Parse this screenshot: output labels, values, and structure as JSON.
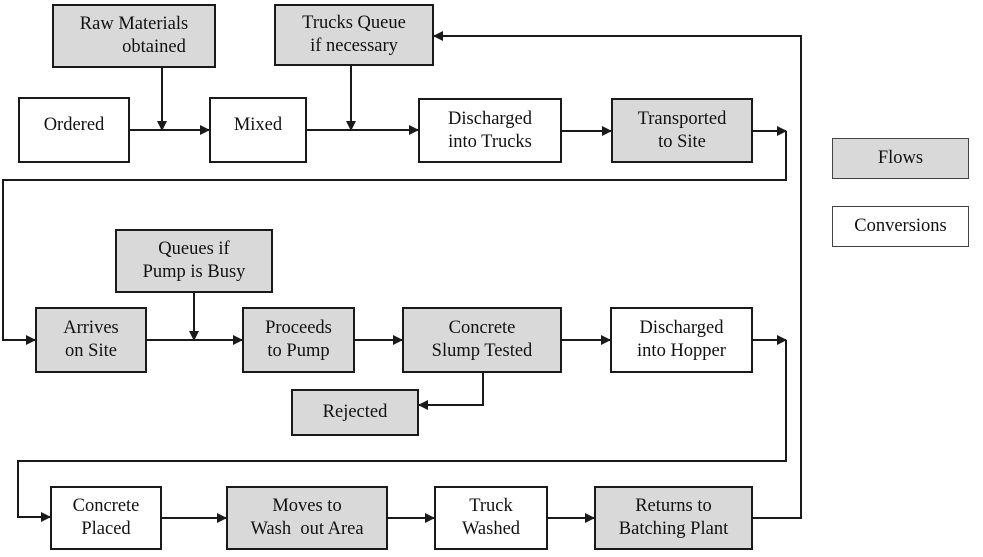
{
  "colors": {
    "flow_fill": "#d9d9d9",
    "conversion_fill": "#ffffff",
    "line": "#1a1a1a"
  },
  "nodes": {
    "raw_materials": {
      "type": "flow",
      "lines": [
        "Raw Materials",
        "obtained"
      ]
    },
    "trucks_queue": {
      "type": "flow",
      "lines": [
        "Trucks Queue",
        "if necessary"
      ]
    },
    "ordered": {
      "type": "conversion",
      "lines": [
        "Ordered"
      ]
    },
    "mixed": {
      "type": "conversion",
      "lines": [
        "Mixed"
      ]
    },
    "discharged_trucks": {
      "type": "conversion",
      "lines": [
        "Discharged",
        "into Trucks"
      ]
    },
    "transported": {
      "type": "flow",
      "lines": [
        "Transported",
        "to Site"
      ]
    },
    "queues_pump": {
      "type": "flow",
      "lines": [
        "Queues if",
        "Pump is Busy"
      ]
    },
    "arrives": {
      "type": "flow",
      "lines": [
        "Arrives",
        "on Site"
      ]
    },
    "proceeds": {
      "type": "flow",
      "lines": [
        "Proceeds",
        "to Pump"
      ]
    },
    "slump": {
      "type": "flow",
      "lines": [
        "Concrete",
        "Slump Tested"
      ]
    },
    "hopper": {
      "type": "conversion",
      "lines": [
        "Discharged",
        "into Hopper"
      ]
    },
    "rejected": {
      "type": "flow",
      "lines": [
        "Rejected"
      ]
    },
    "placed": {
      "type": "conversion",
      "lines": [
        "Concrete",
        "Placed"
      ]
    },
    "washout": {
      "type": "flow",
      "lines": [
        "Moves to",
        "Wash  out Area"
      ]
    },
    "washed": {
      "type": "conversion",
      "lines": [
        "Truck",
        "Washed"
      ]
    },
    "returns": {
      "type": "flow",
      "lines": [
        "Returns to",
        "Batching Plant"
      ]
    }
  },
  "legend": {
    "flows": "Flows",
    "conversions": "Conversions"
  },
  "edges": [
    [
      "ordered",
      "mixed"
    ],
    [
      "raw_materials",
      "ordered-mixed"
    ],
    [
      "mixed",
      "discharged_trucks"
    ],
    [
      "trucks_queue",
      "mixed-discharged_trucks"
    ],
    [
      "discharged_trucks",
      "transported"
    ],
    [
      "transported",
      "arrives"
    ],
    [
      "arrives",
      "proceeds"
    ],
    [
      "queues_pump",
      "arrives-proceeds"
    ],
    [
      "proceeds",
      "slump"
    ],
    [
      "slump",
      "hopper"
    ],
    [
      "slump",
      "rejected"
    ],
    [
      "hopper",
      "placed"
    ],
    [
      "placed",
      "washout"
    ],
    [
      "washout",
      "washed"
    ],
    [
      "washed",
      "returns"
    ],
    [
      "returns",
      "trucks_queue"
    ]
  ]
}
